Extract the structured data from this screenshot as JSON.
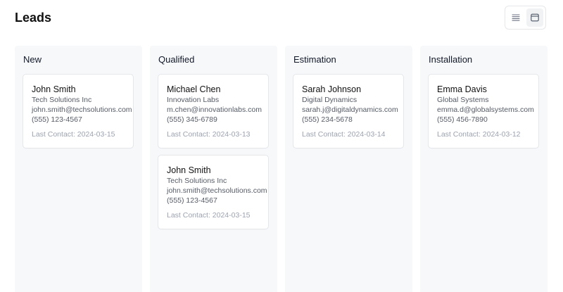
{
  "header": {
    "title": "Leads",
    "view_toggle": {
      "options": [
        "list-view",
        "board-view"
      ],
      "selected": "board-view"
    }
  },
  "columns": [
    {
      "title": "New",
      "cards": [
        {
          "name": "John Smith",
          "company": "Tech Solutions Inc",
          "email": "john.smith@techsolutions.com",
          "phone": "(555) 123-4567",
          "last_contact": "Last Contact: 2024-03-15"
        }
      ]
    },
    {
      "title": "Qualified",
      "cards": [
        {
          "name": "Michael Chen",
          "company": "Innovation Labs",
          "email": "m.chen@innovationlabs.com",
          "phone": "(555) 345-6789",
          "last_contact": "Last Contact: 2024-03-13"
        },
        {
          "name": "John Smith",
          "company": "Tech Solutions Inc",
          "email": "john.smith@techsolutions.com",
          "phone": "(555) 123-4567",
          "last_contact": "Last Contact: 2024-03-15"
        }
      ]
    },
    {
      "title": "Estimation",
      "cards": [
        {
          "name": "Sarah Johnson",
          "company": "Digital Dynamics",
          "email": "sarah.j@digitaldynamics.com",
          "phone": "(555) 234-5678",
          "last_contact": "Last Contact: 2024-03-14"
        }
      ]
    },
    {
      "title": "Installation",
      "cards": [
        {
          "name": "Emma Davis",
          "company": "Global Systems",
          "email": "emma.d@globalsystems.com",
          "phone": "(555) 456-7890",
          "last_contact": "Last Contact: 2024-03-12"
        }
      ]
    }
  ]
}
